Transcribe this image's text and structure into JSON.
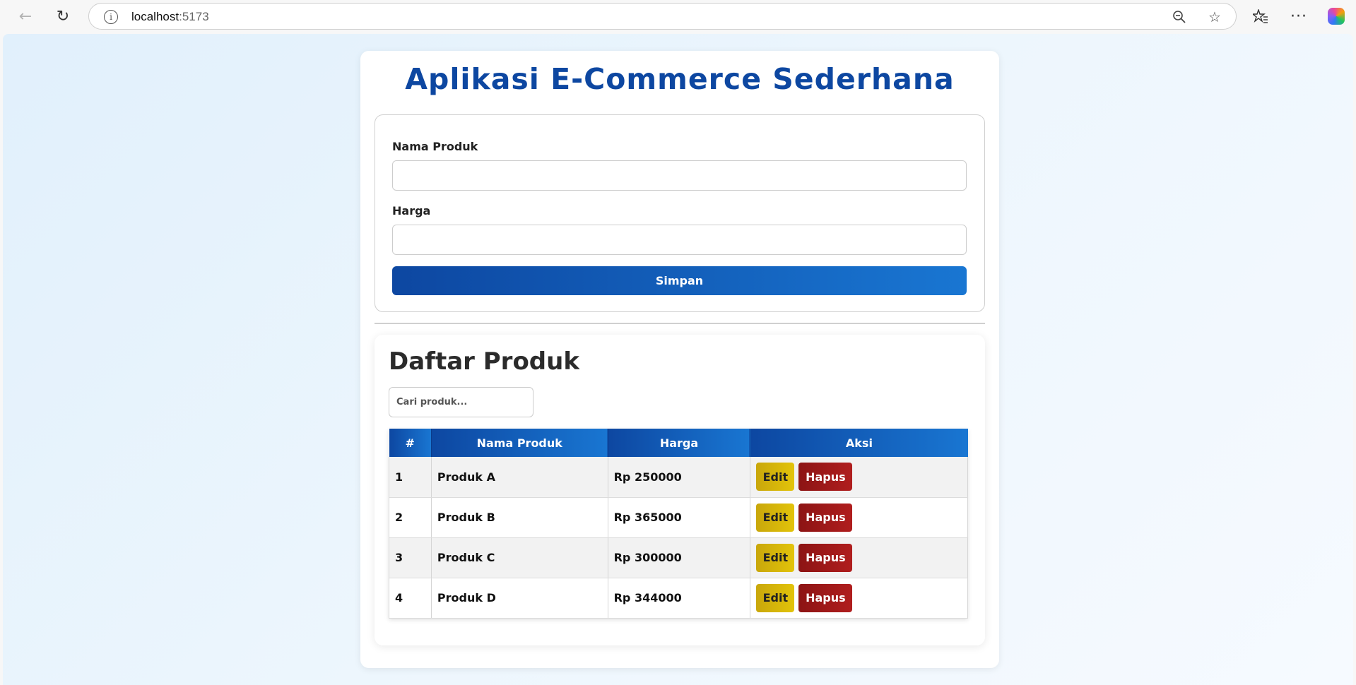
{
  "browser": {
    "url_host": "localhost",
    "url_port": ":5173",
    "icons": {
      "back": "arrow-left-icon",
      "reload": "reload-icon",
      "info": "info-icon",
      "zoom": "zoom-out-icon",
      "star": "star-icon",
      "favorites": "favorites-icon",
      "more": "more-icon",
      "copilot": "copilot-icon"
    }
  },
  "app": {
    "title": "Aplikasi E-Commerce Sederhana"
  },
  "form": {
    "name_label": "Nama Produk",
    "name_value": "",
    "price_label": "Harga",
    "price_value": "",
    "save_label": "Simpan"
  },
  "list": {
    "title": "Daftar Produk",
    "search_placeholder": "Cari produk...",
    "columns": [
      "#",
      "Nama Produk",
      "Harga",
      "Aksi"
    ],
    "edit_label": "Edit",
    "delete_label": "Hapus",
    "rows": [
      {
        "no": "1",
        "name": "Produk A",
        "price": "Rp 250000"
      },
      {
        "no": "2",
        "name": "Produk B",
        "price": "Rp 365000"
      },
      {
        "no": "3",
        "name": "Produk C",
        "price": "Rp 300000"
      },
      {
        "no": "4",
        "name": "Produk D",
        "price": "Rp 344000"
      }
    ]
  },
  "colors": {
    "primary_dark": "#0d47a1",
    "primary_light": "#1976d2",
    "edit_button": "#e2c30a",
    "delete_button": "#b01e1e"
  }
}
